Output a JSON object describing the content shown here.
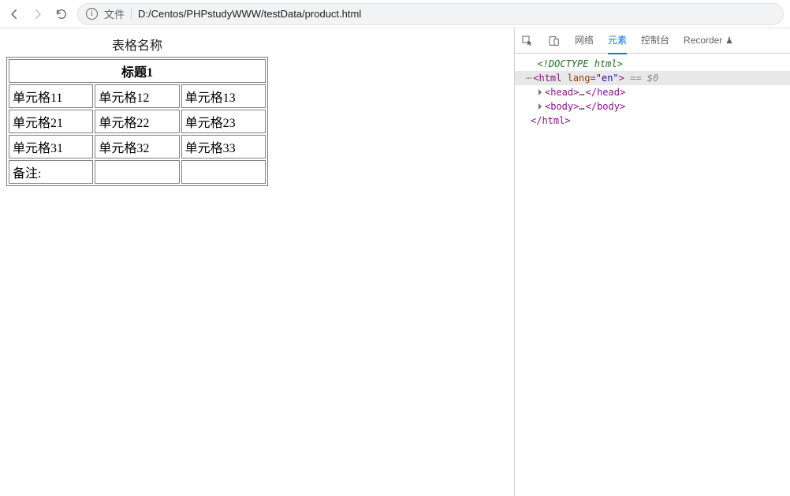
{
  "browser": {
    "url_prefix": "文件",
    "url": "D:/Centos/PHPstudyWWW/testData/product.html"
  },
  "page": {
    "caption": "表格名称",
    "header": "标题1",
    "rows": [
      [
        "单元格11",
        "单元格12",
        "单元格13"
      ],
      [
        "单元格21",
        "单元格22",
        "单元格23"
      ],
      [
        "单元格31",
        "单元格32",
        "单元格33"
      ]
    ],
    "footer_label": "备注:"
  },
  "devtools": {
    "tabs": {
      "network": "网络",
      "elements": "元素",
      "console": "控制台",
      "recorder": "Recorder"
    },
    "dom": {
      "doctype": "<!DOCTYPE html>",
      "html_open": "html",
      "lang_attr": "lang",
      "lang_val": "\"en\"",
      "eq0": "== $0",
      "head": "head",
      "body": "body",
      "html_close": "</html>"
    }
  }
}
